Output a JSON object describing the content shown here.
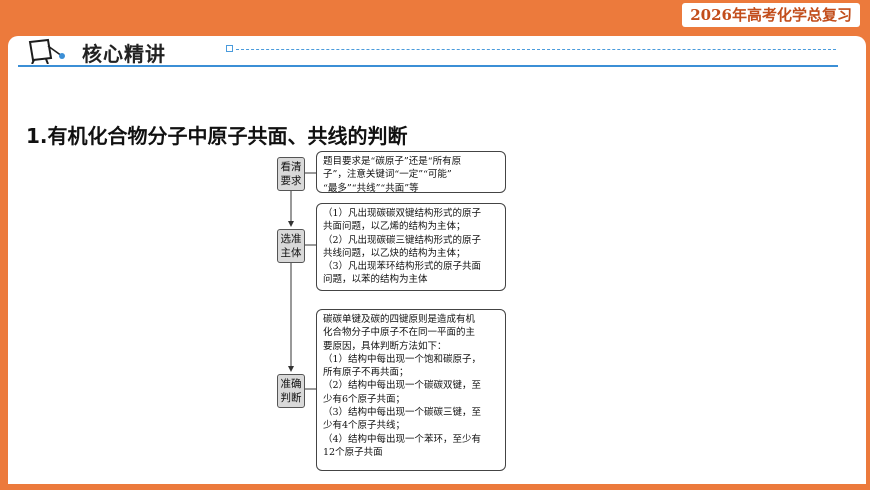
{
  "header": {
    "badge": "2026年高考化学总复习"
  },
  "section": {
    "title": "核心精讲"
  },
  "main_heading": "1.有机化合物分子中原子共面、共线的判断",
  "flow": [
    {
      "label_line1": "看清",
      "label_line2": "要求",
      "lines": [
        "题目要求是“碳原子”还是“所有原",
        "子”，注意关键词“一定”“可能”",
        "“最多”“共线”“共面”等"
      ]
    },
    {
      "label_line1": "选准",
      "label_line2": "主体",
      "lines": [
        "（1）凡出现碳碳双键结构形式的原子",
        "共面问题，以乙烯的结构为主体；",
        "（2）凡出现碳碳三键结构形式的原子",
        "共线问题，以乙炔的结构为主体；",
        "（3）凡出现苯环结构形式的原子共面",
        "问题，以苯的结构为主体"
      ]
    },
    {
      "label_line1": "准确",
      "label_line2": "判断",
      "lines": [
        "碳碳单键及碳的四键原则是造成有机",
        "化合物分子中原子不在同一平面的主",
        "要原因，具体判断方法如下：",
        "（1）结构中每出现一个饱和碳原子，",
        "所有原子不再共面；",
        "（2）结构中每出现一个碳碳双键，至",
        "少有6个原子共面；",
        "（3）结构中每出现一个碳碳三键，至",
        "少有4个原子共线；",
        "（4）结构中每出现一个苯环，至少有",
        "12个原子共面"
      ]
    }
  ],
  "colors": {
    "frame": "#ec7a3c",
    "accent": "#3b8fd6",
    "badge_text": "#c24d1b"
  }
}
